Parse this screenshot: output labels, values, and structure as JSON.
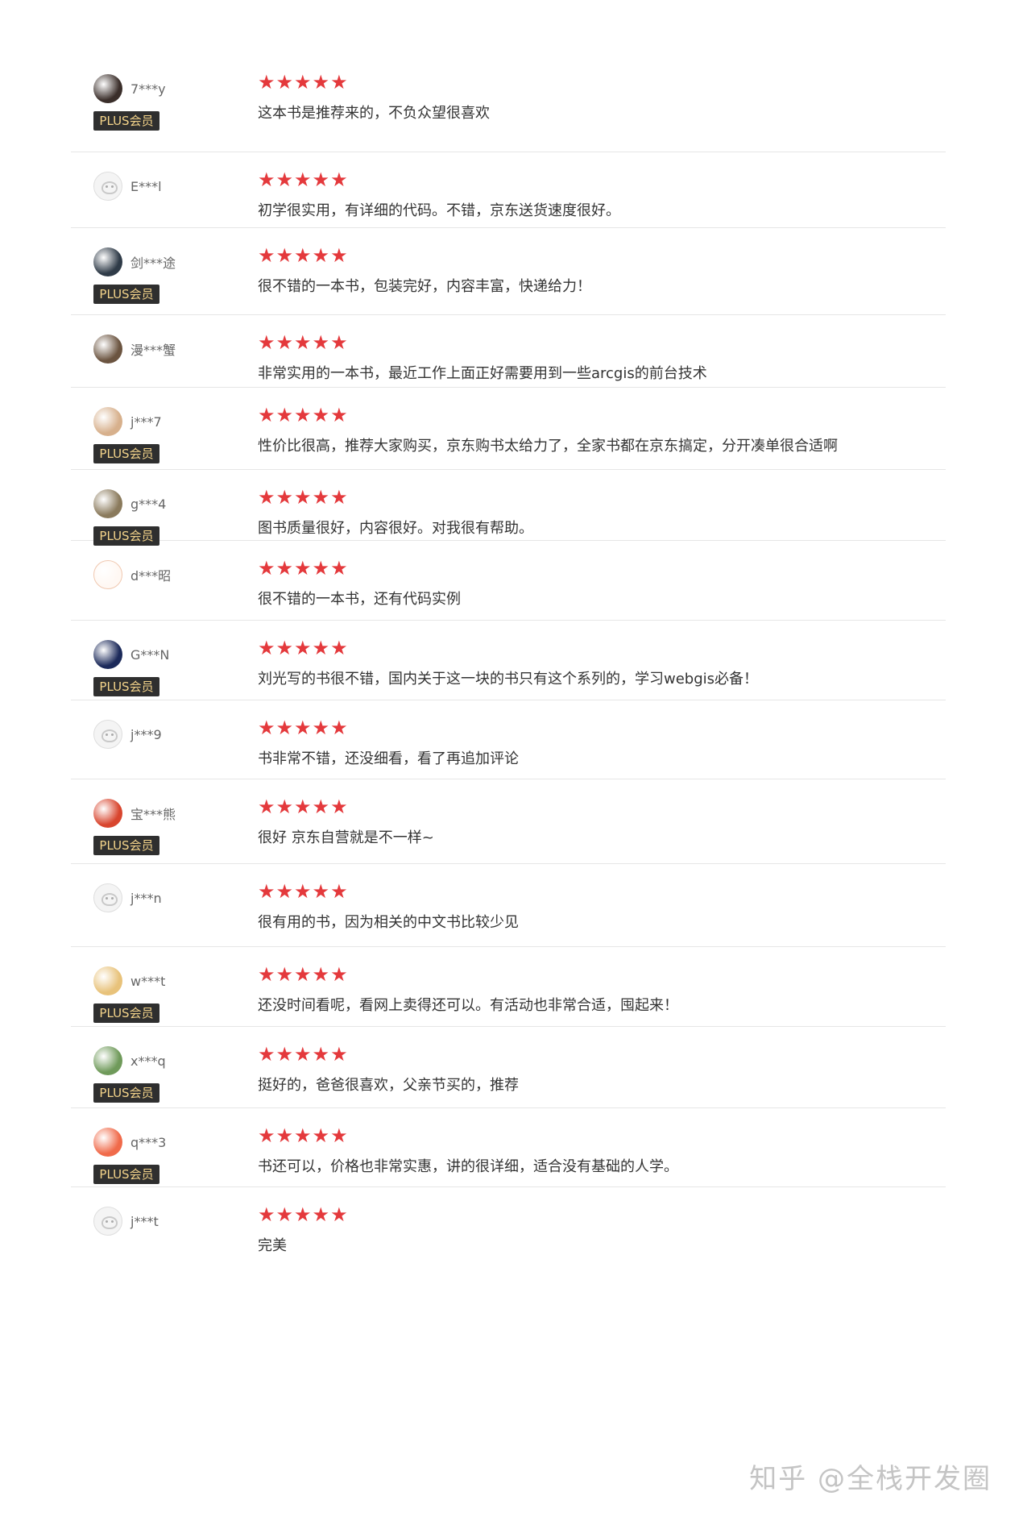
{
  "reviews": [
    {
      "user": "7***y",
      "plus": true,
      "avatar": "dark-photo-avatar",
      "avatar_color": "#3a2e2a",
      "stars": "★★★★★",
      "text": "这本书是推荐来的，不负众望很喜欢"
    },
    {
      "user": "E***l",
      "plus": false,
      "avatar": "default-avatar",
      "avatar_color": "#f4f4f4",
      "stars": "★★★★★",
      "text": "初学很实用，有详细的代码。不错，京东送货速度很好。"
    },
    {
      "user": "剑***途",
      "plus": true,
      "avatar": "dark-photo-avatar",
      "avatar_color": "#2f3b48",
      "stars": "★★★★★",
      "text": "很不错的一本书，包装完好，内容丰富，快递给力！"
    },
    {
      "user": "漫***蟹",
      "plus": false,
      "avatar": "photo-avatar",
      "avatar_color": "#6b5440",
      "stars": "★★★★★",
      "text": "非常实用的一本书，最近工作上面正好需要用到一些arcgis的前台技术"
    },
    {
      "user": "j***7",
      "plus": true,
      "avatar": "girl-photo-avatar",
      "avatar_color": "#d7b08c",
      "stars": "★★★★★",
      "text": "性价比很高，推荐大家购买，京东购书太给力了，全家书都在京东搞定，分开凑单很合适啊"
    },
    {
      "user": "g***4",
      "plus": true,
      "avatar": "photo-avatar",
      "avatar_color": "#8a7a5c",
      "stars": "★★★★★",
      "text": "图书质量很好，内容很好。对我很有帮助。"
    },
    {
      "user": "d***昭",
      "plus": false,
      "avatar": "cat-avatar",
      "avatar_color": "#fff8f3",
      "stars": "★★★★★",
      "text": "很不错的一本书，还有代码实例"
    },
    {
      "user": "G***N",
      "plus": true,
      "avatar": "galaxy-photo-avatar",
      "avatar_color": "#1c2a5a",
      "stars": "★★★★★",
      "text": "刘光写的书很不错，国内关于这一块的书只有这个系列的，学习webgis必备！"
    },
    {
      "user": "j***9",
      "plus": false,
      "avatar": "default-avatar",
      "avatar_color": "#f4f4f4",
      "stars": "★★★★★",
      "text": "书非常不错，还没细看，看了再追加评论"
    },
    {
      "user": "宝***熊",
      "plus": true,
      "avatar": "cartoon-avatar",
      "avatar_color": "#d8452e",
      "stars": "★★★★★",
      "text": "很好 京东自营就是不一样~"
    },
    {
      "user": "j***n",
      "plus": false,
      "avatar": "default-avatar",
      "avatar_color": "#f4f4f4",
      "stars": "★★★★★",
      "text": "很有用的书，因为相关的中文书比较少见"
    },
    {
      "user": "w***t",
      "plus": true,
      "avatar": "cartoon-avatar",
      "avatar_color": "#e8c27a",
      "stars": "★★★★★",
      "text": "还没时间看呢，看网上卖得还可以。有活动也非常合适，囤起来！"
    },
    {
      "user": "x***q",
      "plus": true,
      "avatar": "photo-avatar",
      "avatar_color": "#6f9a5a",
      "stars": "★★★★★",
      "text": "挺好的，爸爸很喜欢，父亲节买的，推荐"
    },
    {
      "user": "q***3",
      "plus": true,
      "avatar": "mail-icon-avatar",
      "avatar_color": "#f06a4a",
      "stars": "★★★★★",
      "text": "书还可以，价格也非常实惠，讲的很详细，适合没有基础的人学。"
    },
    {
      "user": "j***t",
      "plus": false,
      "avatar": "default-avatar",
      "avatar_color": "#f4f4f4",
      "stars": "★★★★★",
      "text": "完美"
    }
  ],
  "badge_label": "PLUS会员",
  "watermark": "知乎 @全栈开发圈",
  "colors": {
    "star": "#e4393c",
    "badge_bg": "#2f2f2f",
    "badge_text": "#f3d38a",
    "divider": "#e6e6e6"
  }
}
